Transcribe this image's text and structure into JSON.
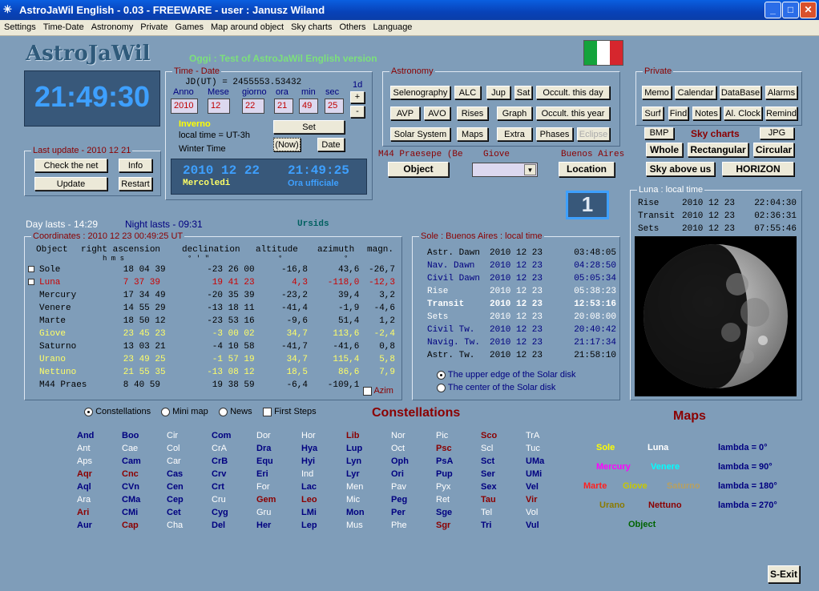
{
  "window": {
    "title": "AstroJaWil English -   0.03 - FREEWARE - user : Janusz Wiland"
  },
  "menu": [
    "Settings",
    "Time-Date",
    "Astronomy",
    "Private",
    "Games",
    "Map around object",
    "Sky charts",
    "Others",
    "Language"
  ],
  "logo": "AstroJaWil",
  "oggi": "Oggi : Test of AstroJaWil English version",
  "clock": "21:49:30",
  "timedate": {
    "label": "Time - Date",
    "jd": "JD(UT) = 2455553.53432",
    "anno_l": "Anno",
    "mese_l": "Mese",
    "giorno_l": "giorno",
    "ora_l": "ora",
    "min_l": "min",
    "sec_l": "sec",
    "step": "1d",
    "anno": "2010",
    "mese": "12",
    "giorno": "22",
    "ora": "21",
    "min": "49",
    "sec": "25",
    "season": "Inverno",
    "localtime": "local time = UT-3h",
    "wintertime": "Winter Time",
    "set": "Set",
    "now": "(Now)",
    "date": "Date",
    "plus": "+",
    "minus": "-",
    "ltd_date": "2010 12 22",
    "ltd_time": "21:49:25",
    "ltd_day": "Mercoledi",
    "ltd_tz": "Ora ufficiale"
  },
  "lastupdate": {
    "label": "Last update - 2010 12 21",
    "check": "Check the net",
    "info": "Info",
    "update": "Update",
    "restart": "Restart"
  },
  "astronomy": {
    "label": "Astronomy",
    "r1": [
      "Selenography",
      "ALC",
      "Jup",
      "Sat",
      "Occult. this day"
    ],
    "r2": [
      "AVP",
      "AVO",
      "Rises",
      "Graph",
      "Occult. this year"
    ],
    "r3": [
      "Solar System",
      "Maps",
      "Extra",
      "Phases",
      "Eclipse"
    ]
  },
  "object_area": {
    "target": "M44 Praesepe (Be",
    "giove": "Giove",
    "city": "Buenos Aires",
    "object": "Object",
    "location": "Location"
  },
  "private": {
    "label": "Private",
    "r1": [
      "Memo",
      "Calendar",
      "DataBase",
      "Alarms"
    ],
    "r2": [
      "Surf",
      "Find",
      "Notes",
      "Al. Clock",
      "Remind"
    ]
  },
  "skycharts": {
    "bmp": "BMP",
    "title": "Sky charts",
    "jpg": "JPG",
    "whole": "Whole",
    "rect": "Rectangular",
    "circ": "Circular",
    "above": "Sky above us",
    "horizon": "HORIZON"
  },
  "badge": "1",
  "daylasts": "Day lasts - 14:29",
  "nightlasts": "Night lasts - 09:31",
  "meteor": "Ursids",
  "coords": {
    "label": "Coordinates : 2010 12 23  00:49:25 UT",
    "headers": [
      "Object",
      "right ascension",
      "declination",
      "altitude",
      "azimuth",
      "magn."
    ],
    "units": [
      "h   m   s",
      "°    '    \"",
      "°",
      "°"
    ],
    "azim": "Azim",
    "rows": [
      {
        "name": "Sole",
        "ra": "18 04 39",
        "dec": "-23 26 00",
        "alt": "-16,8",
        "az": "43,6",
        "mag": "-26,7",
        "color": "#000000",
        "chk": true
      },
      {
        "name": "Luna",
        "ra": "7 37 39",
        "dec": "19 41 23",
        "alt": "4,3",
        "az": "-118,0",
        "mag": "-12,3",
        "color": "#cc0000",
        "chk": true
      },
      {
        "name": "Mercury",
        "ra": "17 34 49",
        "dec": "-20 35 39",
        "alt": "-23,2",
        "az": "39,4",
        "mag": "3,2",
        "color": "#000000"
      },
      {
        "name": "Venere",
        "ra": "14 55 29",
        "dec": "-13 18 11",
        "alt": "-41,4",
        "az": "-1,9",
        "mag": "-4,6",
        "color": "#000000"
      },
      {
        "name": "Marte",
        "ra": "18 50 12",
        "dec": "-23 53 16",
        "alt": "-9,6",
        "az": "51,4",
        "mag": "1,2",
        "color": "#000000"
      },
      {
        "name": "Giove",
        "ra": "23 45 23",
        "dec": "-3 00 02",
        "alt": "34,7",
        "az": "113,6",
        "mag": "-2,4",
        "color": "#ffff66"
      },
      {
        "name": "Saturno",
        "ra": "13 03 21",
        "dec": "-4 10 58",
        "alt": "-41,7",
        "az": "-41,6",
        "mag": "0,8",
        "color": "#000000"
      },
      {
        "name": "Urano",
        "ra": "23 49 25",
        "dec": "-1 57 19",
        "alt": "34,7",
        "az": "115,4",
        "mag": "5,8",
        "color": "#ffff66"
      },
      {
        "name": "Nettuno",
        "ra": "21 55 35",
        "dec": "-13 08 12",
        "alt": "18,5",
        "az": "86,6",
        "mag": "7,9",
        "color": "#ffff66"
      },
      {
        "name": "M44 Praes",
        "ra": "8 40 59",
        "dec": "19 38 59",
        "alt": "-6,4",
        "az": "-109,1",
        "mag": "",
        "color": "#000000"
      }
    ]
  },
  "sole": {
    "label": "Sole : Buenos Aires : local time",
    "rows": [
      {
        "n": "Astr. Dawn",
        "d": "2010 12 23",
        "t": "03:48:05",
        "c": "#000000",
        "b": false
      },
      {
        "n": "Nav.  Dawn",
        "d": "2010 12 23",
        "t": "04:28:50",
        "c": "#000080",
        "b": false
      },
      {
        "n": "Civil Dawn",
        "d": "2010 12 23",
        "t": "05:05:34",
        "c": "#000080",
        "b": false
      },
      {
        "n": "Rise",
        "d": "2010 12 23",
        "t": "05:38:23",
        "c": "#ffffff",
        "b": false
      },
      {
        "n": "Transit",
        "d": "2010 12 23",
        "t": "12:53:16",
        "c": "#ffffff",
        "b": true
      },
      {
        "n": "Sets",
        "d": "2010 12 23",
        "t": "20:08:00",
        "c": "#ffffff",
        "b": false
      },
      {
        "n": "Civil  Tw.",
        "d": "2010 12 23",
        "t": "20:40:42",
        "c": "#000080",
        "b": false
      },
      {
        "n": "Navig. Tw.",
        "d": "2010 12 23",
        "t": "21:17:34",
        "c": "#000080",
        "b": false
      },
      {
        "n": "Astr.  Tw.",
        "d": "2010 12 23",
        "t": "21:58:10",
        "c": "#000000",
        "b": false
      }
    ],
    "opt1": "The upper edge of the Solar disk",
    "opt2": "The center of the Solar disk"
  },
  "luna": {
    "label": "Luna : local time",
    "rows": [
      {
        "n": "Rise",
        "d": "2010 12 23",
        "t": "22:04:30"
      },
      {
        "n": "Transit",
        "d": "2010 12 23",
        "t": "02:36:31"
      },
      {
        "n": "Sets",
        "d": "2010 12 23",
        "t": "07:55:46"
      }
    ]
  },
  "tabs": {
    "constellations": "Constellations",
    "minimap": "Mini map",
    "news": "News",
    "firststeps": "First Steps"
  },
  "constellations": {
    "title": "Constellations",
    "cols": [
      [
        [
          "And",
          "#000080",
          1
        ],
        [
          "Ant",
          "#ffffff",
          0
        ],
        [
          "Aps",
          "#ffffff",
          0
        ],
        [
          "Aqr",
          "#8b0000",
          1
        ],
        [
          "Aql",
          "#000080",
          1
        ],
        [
          "Ara",
          "#ffffff",
          0
        ],
        [
          "Ari",
          "#8b0000",
          1
        ],
        [
          "Aur",
          "#000080",
          1
        ]
      ],
      [
        [
          "Boo",
          "#000080",
          1
        ],
        [
          "Cae",
          "#ffffff",
          0
        ],
        [
          "Cam",
          "#000080",
          1
        ],
        [
          "Cnc",
          "#8b0000",
          1
        ],
        [
          "CVn",
          "#000080",
          1
        ],
        [
          "CMa",
          "#000080",
          1
        ],
        [
          "CMi",
          "#000080",
          1
        ],
        [
          "Cap",
          "#8b0000",
          1
        ]
      ],
      [
        [
          "Cir",
          "#ffffff",
          0
        ],
        [
          "Col",
          "#ffffff",
          0
        ],
        [
          "Car",
          "#ffffff",
          0
        ],
        [
          "Cas",
          "#000080",
          1
        ],
        [
          "Cen",
          "#000080",
          1
        ],
        [
          "Cep",
          "#000080",
          1
        ],
        [
          "Cet",
          "#000080",
          1
        ],
        [
          "Cha",
          "#ffffff",
          0
        ]
      ],
      [
        [
          "Com",
          "#000080",
          1
        ],
        [
          "CrA",
          "#ffffff",
          0
        ],
        [
          "CrB",
          "#000080",
          1
        ],
        [
          "Crv",
          "#000080",
          1
        ],
        [
          "Crt",
          "#000080",
          1
        ],
        [
          "Cru",
          "#ffffff",
          0
        ],
        [
          "Cyg",
          "#000080",
          1
        ],
        [
          "Del",
          "#000080",
          1
        ]
      ],
      [
        [
          "Dor",
          "#ffffff",
          0
        ],
        [
          "Dra",
          "#000080",
          1
        ],
        [
          "Equ",
          "#000080",
          1
        ],
        [
          "Eri",
          "#000080",
          1
        ],
        [
          "For",
          "#ffffff",
          0
        ],
        [
          "Gem",
          "#8b0000",
          1
        ],
        [
          "Gru",
          "#ffffff",
          0
        ],
        [
          "Her",
          "#000080",
          1
        ]
      ],
      [
        [
          "Hor",
          "#ffffff",
          0
        ],
        [
          "Hya",
          "#000080",
          1
        ],
        [
          "Hyi",
          "#000080",
          1
        ],
        [
          "Ind",
          "#ffffff",
          0
        ],
        [
          "Lac",
          "#000080",
          1
        ],
        [
          "Leo",
          "#8b0000",
          1
        ],
        [
          "LMi",
          "#000080",
          1
        ],
        [
          "Lep",
          "#000080",
          1
        ]
      ],
      [
        [
          "Lib",
          "#8b0000",
          1
        ],
        [
          "Lup",
          "#000080",
          1
        ],
        [
          "Lyn",
          "#000080",
          1
        ],
        [
          "Lyr",
          "#000080",
          1
        ],
        [
          "Men",
          "#ffffff",
          0
        ],
        [
          "Mic",
          "#ffffff",
          0
        ],
        [
          "Mon",
          "#000080",
          1
        ],
        [
          "Mus",
          "#ffffff",
          0
        ]
      ],
      [
        [
          "Nor",
          "#ffffff",
          0
        ],
        [
          "Oct",
          "#ffffff",
          0
        ],
        [
          "Oph",
          "#000080",
          1
        ],
        [
          "Ori",
          "#000080",
          1
        ],
        [
          "Pav",
          "#ffffff",
          0
        ],
        [
          "Peg",
          "#000080",
          1
        ],
        [
          "Per",
          "#000080",
          1
        ],
        [
          "Phe",
          "#ffffff",
          0
        ]
      ],
      [
        [
          "Pic",
          "#ffffff",
          0
        ],
        [
          "Psc",
          "#8b0000",
          1
        ],
        [
          "PsA",
          "#000080",
          1
        ],
        [
          "Pup",
          "#000080",
          1
        ],
        [
          "Pyx",
          "#ffffff",
          0
        ],
        [
          "Ret",
          "#ffffff",
          0
        ],
        [
          "Sge",
          "#000080",
          1
        ],
        [
          "Sgr",
          "#8b0000",
          1
        ]
      ],
      [
        [
          "Sco",
          "#8b0000",
          1
        ],
        [
          "Scl",
          "#ffffff",
          0
        ],
        [
          "Sct",
          "#000080",
          1
        ],
        [
          "Ser",
          "#000080",
          1
        ],
        [
          "Sex",
          "#000080",
          1
        ],
        [
          "Tau",
          "#8b0000",
          1
        ],
        [
          "Tel",
          "#ffffff",
          0
        ],
        [
          "Tri",
          "#000080",
          1
        ]
      ],
      [
        [
          "TrA",
          "#ffffff",
          0
        ],
        [
          "Tuc",
          "#ffffff",
          0
        ],
        [
          "UMa",
          "#000080",
          1
        ],
        [
          "UMi",
          "#000080",
          1
        ],
        [
          "Vel",
          "#000080",
          1
        ],
        [
          "Vir",
          "#8b0000",
          1
        ],
        [
          "Vol",
          "#ffffff",
          0
        ],
        [
          "Vul",
          "#000080",
          1
        ]
      ]
    ]
  },
  "maps": {
    "title": "Maps",
    "sole": "Sole",
    "luna": "Luna",
    "mercury": "Mercury",
    "venere": "Venere",
    "marte": "Marte",
    "giove": "Giove",
    "saturno": "Saturno",
    "urano": "Urano",
    "nettuno": "Nettuno",
    "object": "Object",
    "l0": "lambda =    0°",
    "l90": "lambda =   90°",
    "l180": "lambda = 180°",
    "l270": "lambda = 270°"
  },
  "exit": "S-Exit"
}
